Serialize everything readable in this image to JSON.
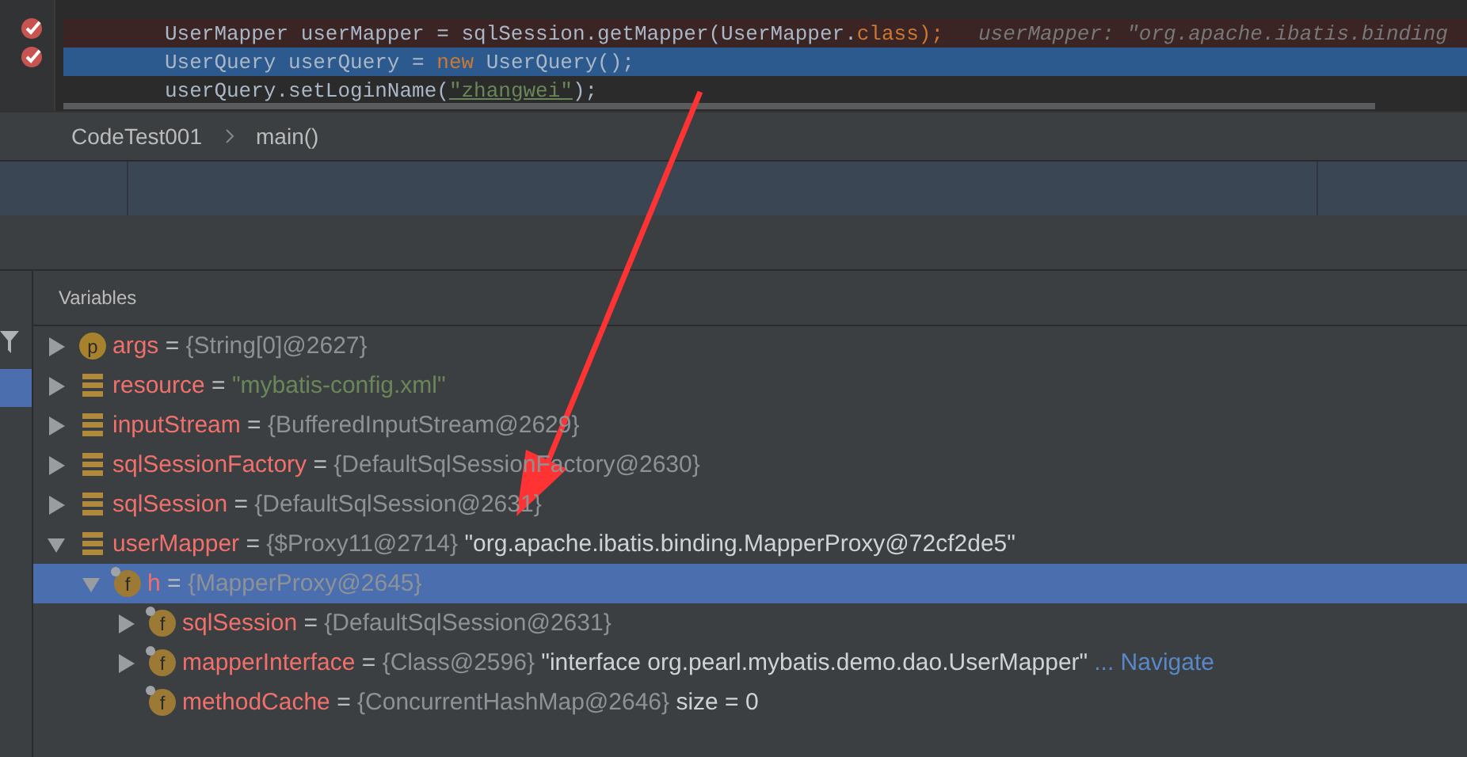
{
  "editor": {
    "lines": [
      {
        "breakpoint": true,
        "selected": false,
        "tokens": [
          {
            "text": "UserMapper userMapper = sqlSession.getMapper(UserMapper.",
            "kind": "plain"
          },
          {
            "text": "class",
            "kind": "keyword"
          },
          {
            "text": ");",
            "kind": "keyword"
          },
          {
            "text": "userMapper: \"org.apache.ibatis.binding",
            "kind": "hint"
          }
        ]
      },
      {
        "breakpoint": true,
        "selected": true,
        "tokens": [
          {
            "text": "UserQuery userQuery = ",
            "kind": "plain"
          },
          {
            "text": "new",
            "kind": "keyword"
          },
          {
            "text": " UserQuery();",
            "kind": "plain"
          }
        ]
      },
      {
        "breakpoint": false,
        "selected": false,
        "tokens": [
          {
            "text": "userQuery.setLoginName(",
            "kind": "plain"
          },
          {
            "text": "\"zhangwei\"",
            "kind": "string"
          },
          {
            "text": ");",
            "kind": "plain"
          }
        ]
      }
    ]
  },
  "breadcrumb": [
    "CodeTest001",
    "main()"
  ],
  "variables": {
    "title": "Variables",
    "items": [
      {
        "kind": "param",
        "badge": "p",
        "expanded": false,
        "name": "args",
        "parts": [
          {
            "text": "=",
            "kind": "op"
          },
          {
            "text": "{String[0]@2627}",
            "kind": "type"
          }
        ],
        "selected": false
      },
      {
        "kind": "local",
        "expanded": false,
        "name": "resource",
        "parts": [
          {
            "text": "=",
            "kind": "op"
          },
          {
            "text": "\"mybatis-config.xml\"",
            "kind": "string"
          }
        ],
        "selected": false
      },
      {
        "kind": "local",
        "expanded": false,
        "name": "inputStream",
        "parts": [
          {
            "text": "=",
            "kind": "op"
          },
          {
            "text": "{BufferedInputStream@2629}",
            "kind": "type"
          }
        ],
        "selected": false
      },
      {
        "kind": "local",
        "expanded": false,
        "name": "sqlSessionFactory",
        "parts": [
          {
            "text": "=",
            "kind": "op"
          },
          {
            "text": "{DefaultSqlSessionFactory@2630}",
            "kind": "type"
          }
        ],
        "selected": false
      },
      {
        "kind": "local",
        "expanded": false,
        "name": "sqlSession",
        "parts": [
          {
            "text": "=",
            "kind": "op"
          },
          {
            "text": "{DefaultSqlSession@2631}",
            "kind": "type"
          }
        ],
        "selected": false
      },
      {
        "kind": "local",
        "expanded": true,
        "name": "userMapper",
        "parts": [
          {
            "text": "=",
            "kind": "op"
          },
          {
            "text": "{$Proxy11@2714}",
            "kind": "type"
          },
          {
            "text": "\"org.apache.ibatis.binding.MapperProxy@72cf2de5\"",
            "kind": "text"
          }
        ],
        "selected": false,
        "children": [
          {
            "kind": "field",
            "badge": "f",
            "expanded": true,
            "name": "h",
            "parts": [
              {
                "text": "=",
                "kind": "op"
              },
              {
                "text": "{MapperProxy@2645}",
                "kind": "type"
              }
            ],
            "selected": true,
            "children": [
              {
                "kind": "field",
                "badge": "f",
                "expanded": false,
                "name": "sqlSession",
                "parts": [
                  {
                    "text": "=",
                    "kind": "op"
                  },
                  {
                    "text": "{DefaultSqlSession@2631}",
                    "kind": "type"
                  }
                ],
                "selected": false
              },
              {
                "kind": "field",
                "badge": "f",
                "expanded": false,
                "name": "mapperInterface",
                "parts": [
                  {
                    "text": "=",
                    "kind": "op"
                  },
                  {
                    "text": "{Class@2596}",
                    "kind": "type"
                  },
                  {
                    "text": "\"interface org.pearl.mybatis.demo.dao.UserMapper\"",
                    "kind": "text"
                  },
                  {
                    "text": "... Navigate",
                    "kind": "link"
                  }
                ],
                "selected": false
              },
              {
                "kind": "field",
                "badge": "f",
                "name": "methodCache",
                "parts": [
                  {
                    "text": "=",
                    "kind": "op"
                  },
                  {
                    "text": "{ConcurrentHashMap@2646}",
                    "kind": "type"
                  },
                  {
                    "text": "size = 0",
                    "kind": "text"
                  }
                ],
                "selected": false
              }
            ]
          }
        ]
      }
    ]
  }
}
